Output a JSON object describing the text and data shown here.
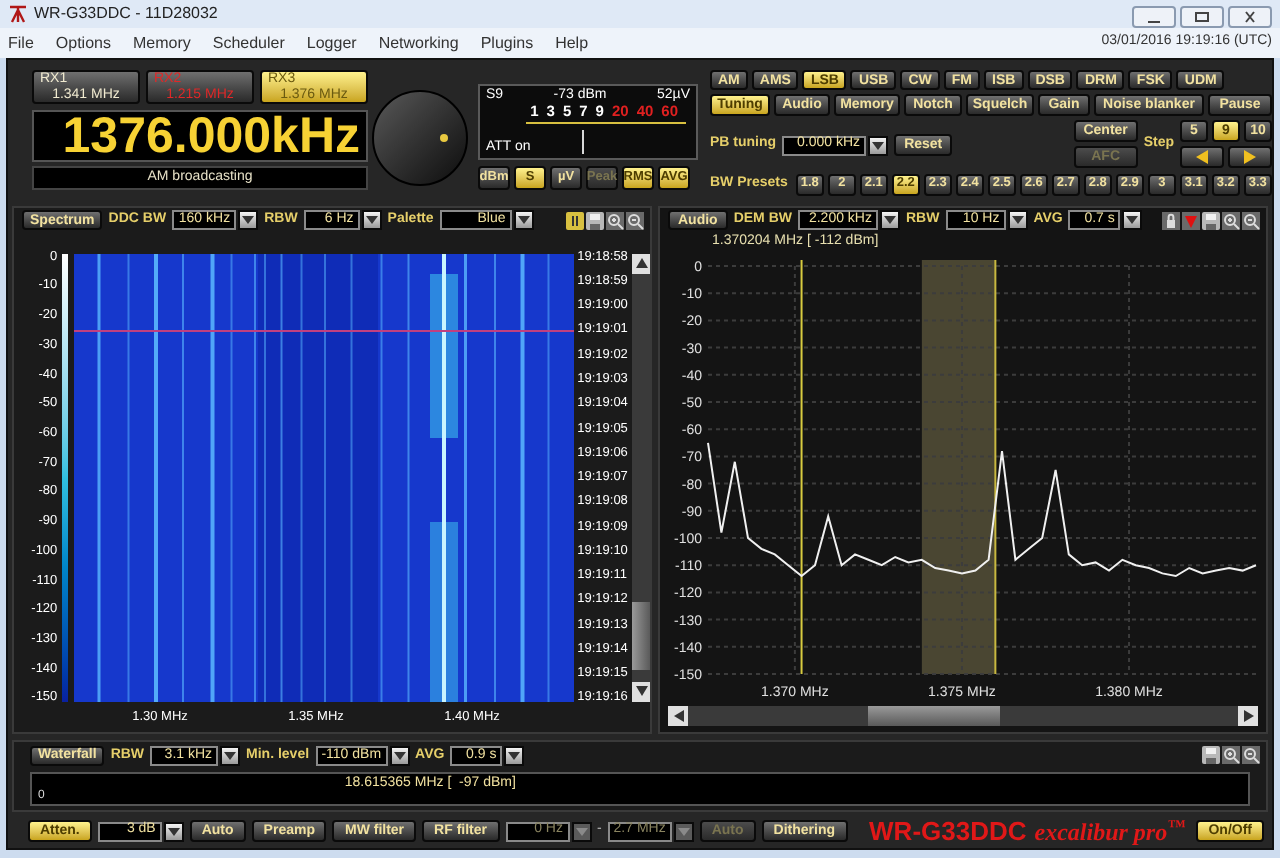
{
  "window": {
    "title": "WR-G33DDC - 11D28032"
  },
  "menu": [
    "File",
    "Options",
    "Memory",
    "Scheduler",
    "Logger",
    "Networking",
    "Plugins",
    "Help"
  ],
  "datetime": "03/01/2016 19:19:16 (UTC)",
  "receivers": [
    {
      "label": "RX1",
      "frequency": "1.341 MHz",
      "selected": false,
      "color": "#f0ead0"
    },
    {
      "label": "RX2",
      "frequency": "1.215 MHz",
      "selected": false,
      "color": "#e02828"
    },
    {
      "label": "RX3",
      "frequency": "1.376 MHz",
      "selected": true,
      "color": "#6a5a10"
    }
  ],
  "frequency_display": "1376.000kHz",
  "band_name": "AM broadcasting",
  "s_meter": {
    "s_reading": "S9",
    "dbm": "-73 dBm",
    "microvolts": "52µV",
    "att": "ATT on",
    "level": 0.47,
    "scale": [
      {
        "label": "1",
        "color": "#ffffff"
      },
      {
        "label": "3",
        "color": "#ffffff"
      },
      {
        "label": "5",
        "color": "#ffffff"
      },
      {
        "label": "7",
        "color": "#ffffff"
      },
      {
        "label": "9",
        "color": "#ffffff"
      },
      {
        "label": "20",
        "color": "#e02020"
      },
      {
        "label": "40",
        "color": "#e02020"
      },
      {
        "label": "60",
        "color": "#e02020"
      }
    ]
  },
  "meter_buttons": [
    {
      "label": "dBm",
      "selected": false,
      "disabled": false
    },
    {
      "label": "S",
      "selected": true,
      "disabled": false
    },
    {
      "label": "µV",
      "selected": false,
      "disabled": false
    },
    {
      "label": "Peak",
      "selected": false,
      "disabled": true
    },
    {
      "label": "RMS",
      "selected": true,
      "disabled": false
    },
    {
      "label": "AVG",
      "selected": true,
      "disabled": false
    }
  ],
  "modes": [
    {
      "label": "AM",
      "selected": false
    },
    {
      "label": "AMS",
      "selected": false
    },
    {
      "label": "LSB",
      "selected": true
    },
    {
      "label": "USB",
      "selected": false
    },
    {
      "label": "CW",
      "selected": false
    },
    {
      "label": "FM",
      "selected": false
    },
    {
      "label": "ISB",
      "selected": false
    },
    {
      "label": "DSB",
      "selected": false
    },
    {
      "label": "DRM",
      "selected": false
    },
    {
      "label": "FSK",
      "selected": false
    },
    {
      "label": "UDM",
      "selected": false
    }
  ],
  "function_tabs": [
    {
      "label": "Tuning",
      "selected": true
    },
    {
      "label": "Audio",
      "selected": false
    },
    {
      "label": "Memory",
      "selected": false
    },
    {
      "label": "Notch",
      "selected": false
    },
    {
      "label": "Squelch",
      "selected": false
    },
    {
      "label": "Gain",
      "selected": false
    },
    {
      "label": "Noise blanker",
      "selected": false
    },
    {
      "label": "Pause",
      "selected": false
    }
  ],
  "pb_tuning": {
    "label": "PB tuning",
    "value": "0.000 kHz",
    "reset": "Reset"
  },
  "center": "Center",
  "afc": {
    "label": "AFC",
    "disabled": true
  },
  "step": {
    "label": "Step",
    "options": [
      {
        "label": "5",
        "selected": false
      },
      {
        "label": "9",
        "selected": true
      },
      {
        "label": "10",
        "selected": false
      }
    ]
  },
  "bw_presets": {
    "label": "BW Presets",
    "options": [
      {
        "label": "1.8",
        "selected": false
      },
      {
        "label": "2",
        "selected": false
      },
      {
        "label": "2.1",
        "selected": false
      },
      {
        "label": "2.2",
        "selected": true
      },
      {
        "label": "2.3",
        "selected": false
      },
      {
        "label": "2.4",
        "selected": false
      },
      {
        "label": "2.5",
        "selected": false
      },
      {
        "label": "2.6",
        "selected": false
      },
      {
        "label": "2.7",
        "selected": false
      },
      {
        "label": "2.8",
        "selected": false
      },
      {
        "label": "2.9",
        "selected": false
      },
      {
        "label": "3",
        "selected": false
      },
      {
        "label": "3.1",
        "selected": false
      },
      {
        "label": "3.2",
        "selected": false
      },
      {
        "label": "3.3",
        "selected": false
      }
    ]
  },
  "spectrum_panel": {
    "mode_button": "Spectrum",
    "ddc_bw": {
      "label": "DDC BW",
      "value": "160 kHz"
    },
    "rbw": {
      "label": "RBW",
      "value": "6 Hz"
    },
    "palette": {
      "label": "Palette",
      "value": "Blue"
    },
    "y_labels": [
      "0",
      "-10",
      "-20",
      "-30",
      "-40",
      "-50",
      "-60",
      "-70",
      "-80",
      "-90",
      "-100",
      "-110",
      "-120",
      "-130",
      "-140",
      "-150"
    ],
    "time_labels": [
      "19:18:58",
      "19:18:59",
      "19:19:00",
      "19:19:01",
      "19:19:02",
      "19:19:03",
      "19:19:04",
      "19:19:05",
      "19:19:06",
      "19:19:07",
      "19:19:08",
      "19:19:09",
      "19:19:10",
      "19:19:11",
      "19:19:12",
      "19:19:13",
      "19:19:14",
      "19:19:15",
      "19:19:16"
    ],
    "x_labels": [
      "1.30 MHz",
      "1.35 MHz",
      "1.40 MHz"
    ]
  },
  "audio_panel": {
    "mode_button": "Audio",
    "dem_bw": {
      "label": "DEM BW",
      "value": "2.200 kHz"
    },
    "rbw": {
      "label": "RBW",
      "value": "10 Hz"
    },
    "avg": {
      "label": "AVG",
      "value": "0.7 s"
    },
    "readout": "1.370204 MHz [ -112 dBm]",
    "chart_data": {
      "type": "line",
      "x": [
        1.3674,
        1.3678,
        1.3682,
        1.3686,
        1.369,
        1.3694,
        1.3698,
        1.3702,
        1.3706,
        1.371,
        1.3714,
        1.3718,
        1.3722,
        1.3726,
        1.373,
        1.3734,
        1.3738,
        1.3742,
        1.3746,
        1.375,
        1.3754,
        1.3758,
        1.3762,
        1.3766,
        1.377,
        1.3774,
        1.3778,
        1.3782,
        1.3786,
        1.379,
        1.3794,
        1.3798,
        1.3802,
        1.3806,
        1.381,
        1.3814,
        1.3818,
        1.3822,
        1.3826,
        1.383,
        1.3834,
        1.3838
      ],
      "series": [
        {
          "color": "#f0f0f0",
          "values": [
            -65,
            -98,
            -72,
            -100,
            -104,
            -106,
            -110,
            -114,
            -110,
            -92,
            -110,
            -106,
            -108,
            -110,
            -107,
            -109,
            -108,
            -111,
            -112,
            -113,
            -112,
            -108,
            -68,
            -108,
            -104,
            -100,
            -75,
            -106,
            -110,
            -109,
            -112,
            -108,
            -110,
            -111,
            -113,
            -114,
            -111,
            -113,
            -112,
            -111,
            -112,
            -110
          ]
        }
      ],
      "xlim": [
        1.3674,
        1.3838
      ],
      "ylim": [
        -150,
        0
      ],
      "yticks": [
        0,
        -10,
        -20,
        -30,
        -40,
        -50,
        -60,
        -70,
        -80,
        -90,
        -100,
        -110,
        -120,
        -130,
        -140,
        -150
      ],
      "xticks": [
        {
          "value": 1.37,
          "label": "1.370 MHz"
        },
        {
          "value": 1.375,
          "label": "1.375 MHz"
        },
        {
          "value": 1.38,
          "label": "1.380 MHz"
        }
      ],
      "grid": true,
      "ref_lines": [
        {
          "axis": "x",
          "value": 1.3702,
          "color": "#d8cc40"
        },
        {
          "axis": "x",
          "value": 1.376,
          "color": "#c8b840"
        }
      ],
      "bands": [
        {
          "axis": "x",
          "from": 1.3738,
          "to": 1.376
        }
      ]
    }
  },
  "waterfall_panel": {
    "mode_button": "Waterfall",
    "rbw": {
      "label": "RBW",
      "value": "3.1 kHz"
    },
    "min_level": {
      "label": "Min. level",
      "value": "-110 dBm"
    },
    "avg": {
      "label": "AVG",
      "value": "0.9 s"
    },
    "axis_label": "0",
    "readout": "18.615365 MHz [  -97 dBm]"
  },
  "bottom_controls": [
    {
      "kind": "button",
      "label": "Atten.",
      "selected": true,
      "disabled": false
    },
    {
      "kind": "dropdown",
      "value": "3 dB",
      "disabled": false
    },
    {
      "kind": "button",
      "label": "Auto",
      "selected": false,
      "disabled": false
    },
    {
      "kind": "button",
      "label": "Preamp",
      "selected": false,
      "disabled": false
    },
    {
      "kind": "button",
      "label": "MW filter",
      "selected": false,
      "disabled": false
    },
    {
      "kind": "button",
      "label": "RF filter",
      "selected": false,
      "disabled": false
    },
    {
      "kind": "dropdown",
      "value": "0 Hz",
      "disabled": true
    },
    {
      "kind": "text",
      "label": "-"
    },
    {
      "kind": "dropdown",
      "value": "2.7 MHz",
      "disabled": true
    },
    {
      "kind": "button",
      "label": "Auto",
      "selected": false,
      "disabled": true
    },
    {
      "kind": "button",
      "label": "Dithering",
      "selected": false,
      "disabled": false
    }
  ],
  "logo": {
    "name": "WR-G33DDC",
    "tagline": "excalibur pro$^{™}$"
  },
  "power_button": "On/Off"
}
